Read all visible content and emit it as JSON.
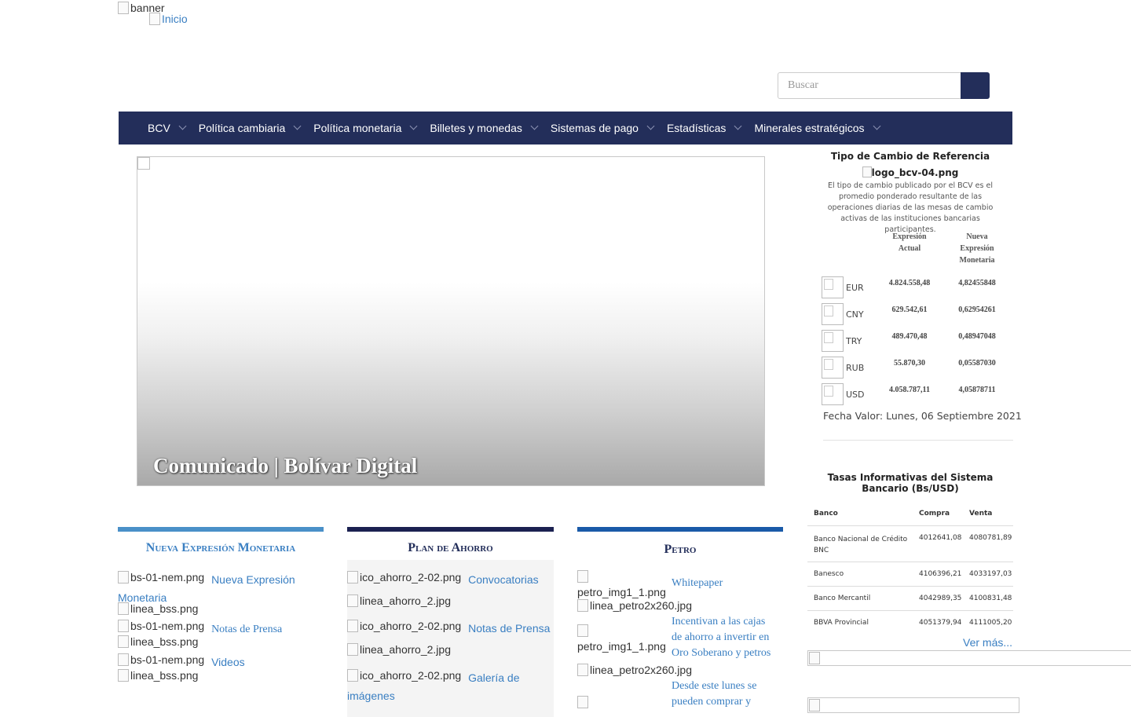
{
  "header": {
    "banner_alt": "banner",
    "home_link": "Inicio",
    "search": {
      "placeholder": "Buscar"
    }
  },
  "nav": {
    "items": [
      {
        "label": "BCV"
      },
      {
        "label": "Política cambiaria"
      },
      {
        "label": "Política monetaria"
      },
      {
        "label": "Billetes y monedas"
      },
      {
        "label": "Sistemas de pago"
      },
      {
        "label": "Estadísticas"
      },
      {
        "label": "Minerales estratégicos"
      }
    ]
  },
  "slider": {
    "caption": "Comunicado | Bolívar Digital"
  },
  "exchange": {
    "title": "Tipo de Cambio de Referencia",
    "logo_alt": "logo_bcv-04.png",
    "description": "El tipo de cambio publicado por el BCV es el promedio ponderado resultante de las operaciones diarias de las mesas de cambio activas de las instituciones bancarias participantes.",
    "col_current": "Expresión Actual",
    "col_new": "Nueva Expresión Monetaria",
    "rows": [
      {
        "code": "EUR",
        "current": "4.824.558,48",
        "new": "4,82455848"
      },
      {
        "code": "CNY",
        "current": "629.542,61",
        "new": "0,62954261"
      },
      {
        "code": "TRY",
        "current": "489.470,48",
        "new": "0,48947048"
      },
      {
        "code": "RUB",
        "current": "55.870,30",
        "new": "0,05587030"
      },
      {
        "code": "USD",
        "current": "4.058.787,11",
        "new": "4,05878711"
      }
    ],
    "date_value": "Fecha Valor: Lunes, 06 Septiembre 2021"
  },
  "bank_rates": {
    "title": "Tasas Informativas del Sistema Bancario (Bs/USD)",
    "headers": {
      "bank": "Banco",
      "buy": "Compra",
      "sell": "Venta"
    },
    "rows": [
      {
        "bank": "Banco Nacional de Crédito BNC",
        "buy": "4012641,08",
        "sell": "4080781,89"
      },
      {
        "bank": "Banesco",
        "buy": "4106396,21",
        "sell": "4033197,03"
      },
      {
        "bank": "Banco Mercantil",
        "buy": "4042989,35",
        "sell": "4100831,48"
      },
      {
        "bank": "BBVA Provincial",
        "buy": "4051379,94",
        "sell": "4111005,20"
      }
    ],
    "more_link": "Ver más..."
  },
  "columns": {
    "nem": {
      "title": "Nueva Expresión Monetaria",
      "bar_color": "#4a90c8",
      "icon_alt": "bs-01-nem.png",
      "line_alt": "linea_bss.png",
      "items": [
        "Nueva Expresión Monetaria",
        "Notas de Prensa",
        "Videos"
      ]
    },
    "ahorro": {
      "title": "Plan de Ahorro",
      "bar_color": "#1b2151",
      "icon_alt": "ico_ahorro_2-02.png",
      "line_alt": "linea_ahorro_2.jpg",
      "items": [
        "Convocatorias",
        "Notas de Prensa",
        "Galería de imágenes"
      ]
    },
    "petro": {
      "title": "Petro",
      "bar_color": "#1a5aa8",
      "icon_alt": "petro_img1_1.png",
      "line_alt": "linea_petro2x260.jpg",
      "items": [
        "Whitepaper",
        "Incentivan a las cajas de ahorro a invertir en Oro Soberano y petros",
        "Desde este lunes se pueden comprar y"
      ]
    }
  },
  "colors": {
    "nav_bg": "#232e5a",
    "link": "#3a7fc2",
    "title_navy": "#232e5a"
  }
}
